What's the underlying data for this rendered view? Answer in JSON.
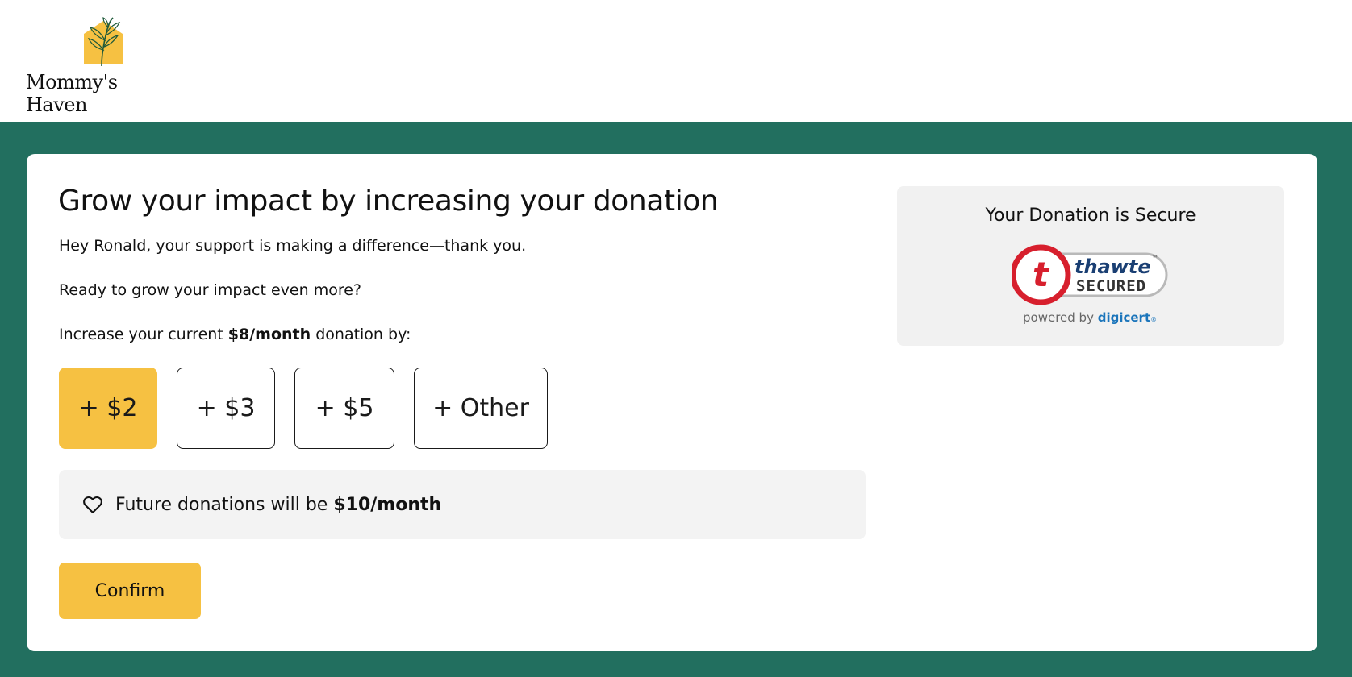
{
  "header": {
    "logo_text": "Mommy's Haven",
    "logo_icon": "house-plant-icon"
  },
  "main": {
    "headline": "Grow your impact by increasing your donation",
    "greeting": "Hey Ronald, your support is making a difference—thank you.",
    "prompt": "Ready to grow your impact even more?",
    "increase_prefix": "Increase your current ",
    "current_amount": "$8/month",
    "increase_suffix": " donation by:",
    "amount_options": [
      {
        "label": "+ $2",
        "selected": true
      },
      {
        "label": "+ $3",
        "selected": false
      },
      {
        "label": "+ $5",
        "selected": false
      },
      {
        "label": "+ Other",
        "selected": false
      }
    ],
    "future_prefix": "Future donations will be ",
    "future_amount": "$10/month",
    "future_icon": "heart-icon",
    "confirm_label": "Confirm"
  },
  "secure_panel": {
    "title": "Your Donation is Secure",
    "seal": {
      "brand": "thawte",
      "trademark": "™",
      "status": "SECURED",
      "powered_prefix": "powered by ",
      "powered_brand": "digicert",
      "registered": "®"
    }
  },
  "colors": {
    "band": "#226f5f",
    "accent": "#f6c142",
    "seal_red": "#d71f2d",
    "digicert_blue": "#1b75bb"
  }
}
